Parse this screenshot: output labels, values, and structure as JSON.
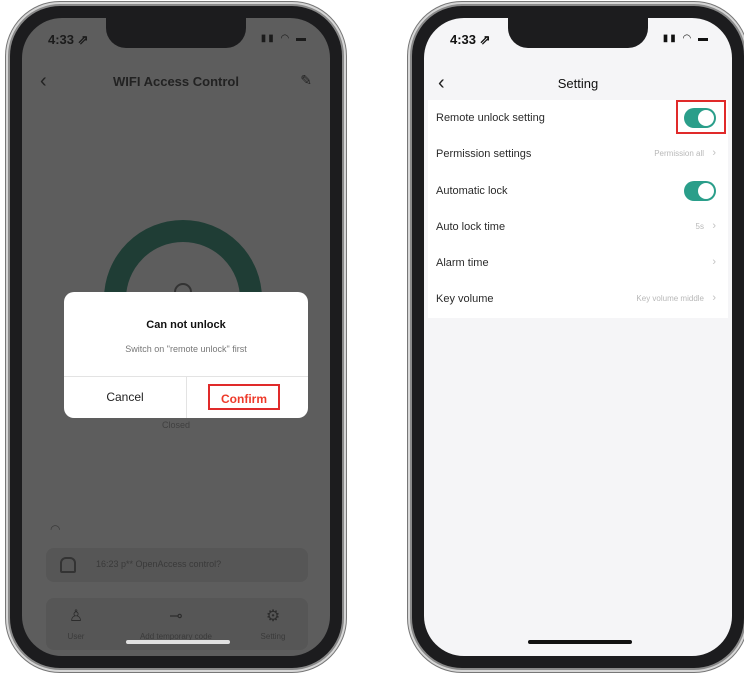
{
  "left_phone": {
    "status": {
      "time": "4:33 ⇗",
      "icons": "▮▮ ◠ ▬"
    },
    "nav": {
      "back_icon": "chevron-left-icon",
      "title": "WIFI Access Control",
      "edit_icon": "edit-icon"
    },
    "lock_state": "Closed",
    "log": {
      "text": "16:23  p** OpenAccess control?"
    },
    "tabs": [
      {
        "label": "User",
        "icon": "user-icon"
      },
      {
        "label": "Add temporary code",
        "icon": "key-icon"
      },
      {
        "label": "Setting",
        "icon": "gear-icon"
      }
    ],
    "dialog": {
      "title": "Can not unlock",
      "message": "Switch on \"remote unlock\" first",
      "cancel_label": "Cancel",
      "confirm_label": "Confirm"
    }
  },
  "right_phone": {
    "status": {
      "time": "4:33 ⇗",
      "icons": "▮▮ ◠ ▬"
    },
    "nav": {
      "back_icon": "chevron-left-icon",
      "title": "Setting"
    },
    "settings": [
      {
        "label": "Remote unlock setting",
        "value": "",
        "toggle": true,
        "toggle_on": true,
        "highlighted": true
      },
      {
        "label": "Permission settings",
        "value": "Permission all",
        "toggle": false
      },
      {
        "label": "Automatic lock",
        "value": "",
        "toggle": true,
        "toggle_on": true
      },
      {
        "label": "Auto lock time",
        "value": "5s",
        "toggle": false
      },
      {
        "label": "Alarm time",
        "value": "",
        "toggle": false
      },
      {
        "label": "Key volume",
        "value": "Key volume middle",
        "toggle": false
      }
    ],
    "accent_color": "#2a9e8a",
    "highlight_color": "#e02a2a"
  }
}
